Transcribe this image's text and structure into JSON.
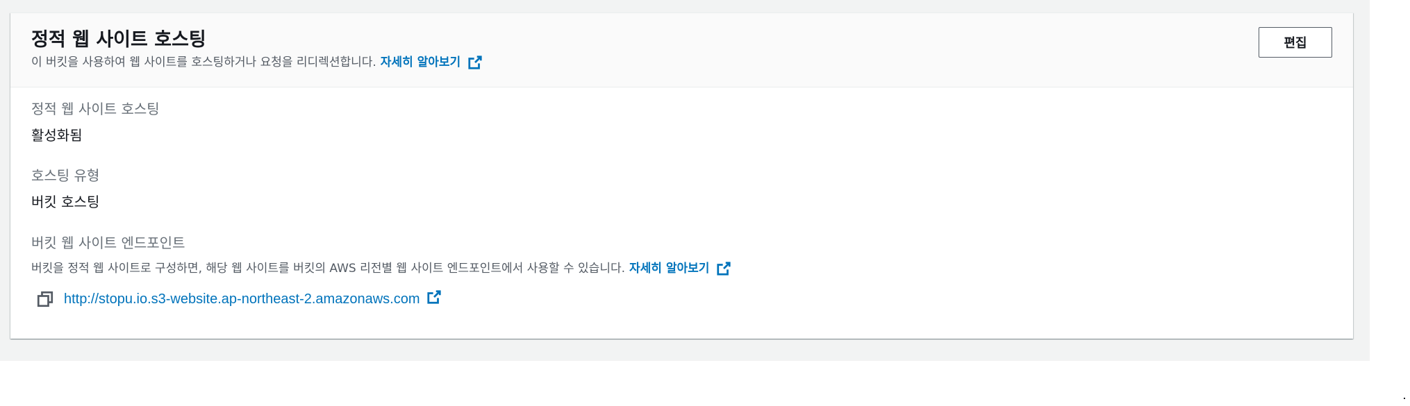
{
  "header": {
    "title": "정적 웹 사이트 호스팅",
    "description": "이 버킷을 사용하여 웹 사이트를 호스팅하거나 요청을 리디렉션합니다.",
    "learn_more": "자세히 알아보기",
    "edit_label": "편집"
  },
  "fields": {
    "hosting_label": "정적 웹 사이트 호스팅",
    "hosting_value": "활성화됨",
    "type_label": "호스팅 유형",
    "type_value": "버킷 호스팅",
    "endpoint_label": "버킷 웹 사이트 엔드포인트",
    "endpoint_description": "버킷을 정적 웹 사이트로 구성하면, 해당 웹 사이트를 버킷의 AWS 리전별 웹 사이트 엔드포인트에서 사용할 수 있습니다.",
    "endpoint_learn_more": "자세히 알아보기",
    "endpoint_url": "http://stopu.io.s3-website.ap-northeast-2.amazonaws.com"
  },
  "icons": {
    "external_link": "external-link-icon",
    "copy": "copy-icon"
  },
  "colors": {
    "link": "#0073bb",
    "text_primary": "#16191f",
    "text_secondary": "#545b64",
    "label": "#687078",
    "background": "#f2f3f3"
  }
}
